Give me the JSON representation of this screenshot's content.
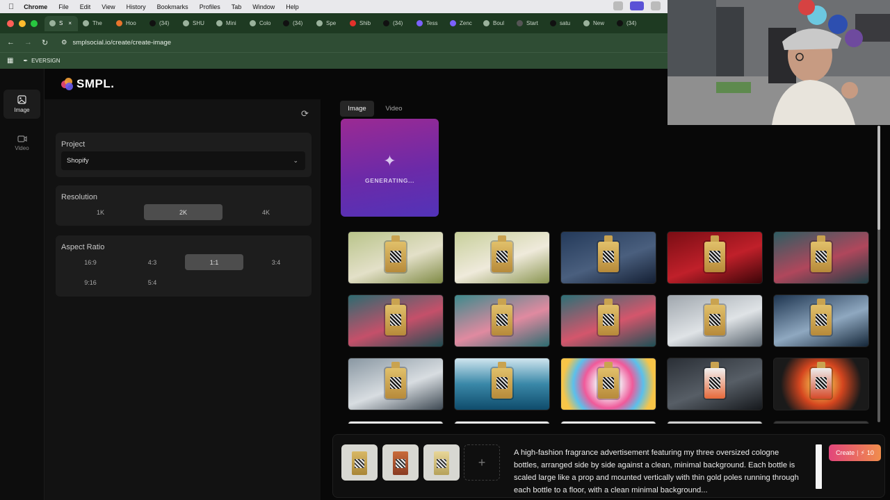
{
  "menubar": {
    "app": "Chrome",
    "items": [
      "File",
      "Edit",
      "View",
      "History",
      "Bookmarks",
      "Profiles",
      "Tab",
      "Window",
      "Help"
    ]
  },
  "browser": {
    "tabs": [
      "S",
      "The",
      "Hoo",
      "(34)",
      "SHU",
      "Mini",
      "Colo",
      "(34)",
      "Spe",
      "Shib",
      "(34)",
      "Tess",
      "Zenc",
      "Boul",
      "Start",
      "satu",
      "New",
      "(34)"
    ],
    "url": "smplsocial.io/create/create-image",
    "bookmark": "EVERSIGN"
  },
  "colors": {
    "accent_gradient_start": "#e2467b",
    "accent_gradient_end": "#f08d4c",
    "generating_bg": "#7a2aa3",
    "chrome_green": "#2f4d34"
  },
  "app": {
    "logo": "SMPL.",
    "rail": [
      {
        "label": "Image",
        "icon": "image-icon",
        "active": true
      },
      {
        "label": "Video",
        "icon": "video-icon",
        "active": false
      }
    ],
    "project": {
      "label": "Project",
      "value": "Shopify"
    },
    "resolution": {
      "label": "Resolution",
      "options": [
        "1K",
        "2K",
        "4K"
      ],
      "selected": "2K"
    },
    "aspect_ratio": {
      "label": "Aspect Ratio",
      "options": [
        "16:9",
        "4:3",
        "1:1",
        "3:4",
        "9:16",
        "5:4"
      ],
      "selected": "1:1"
    },
    "media_tabs": [
      "Image",
      "Video"
    ],
    "generating_text": "GENERATING...",
    "prompt_text": "A high-fashion fragrance advertisement featuring my three oversized cologne bottles, arranged side by side against a clean, minimal background. Each bottle is scaled large like a prop and mounted vertically with thin gold poles running through each bottle to a floor, with a clean minimal background...",
    "create_label": "Create",
    "create_cost": "10"
  }
}
